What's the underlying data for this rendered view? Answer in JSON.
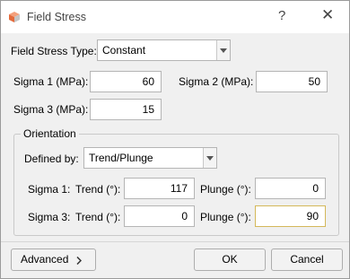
{
  "window": {
    "title": "Field Stress",
    "help_label": "?",
    "close_label": "✕",
    "icon_colors": [
      "#e46a3b",
      "#f3a07c",
      "#c4c4c4"
    ]
  },
  "field_stress_type": {
    "label": "Field Stress Type:",
    "value": "Constant"
  },
  "sigma": {
    "s1_label": "Sigma 1 (MPa):",
    "s1_value": "60",
    "s2_label": "Sigma 2 (MPa):",
    "s2_value": "50",
    "s3_label": "Sigma 3 (MPa):",
    "s3_value": "15"
  },
  "orientation": {
    "title": "Orientation",
    "defined_by_label": "Defined by:",
    "defined_by_value": "Trend/Plunge",
    "rows": [
      {
        "label": "Sigma 1:",
        "trend_label": "Trend (°):",
        "trend": "117",
        "plunge_label": "Plunge (°):",
        "plunge": "0"
      },
      {
        "label": "Sigma 3:",
        "trend_label": "Trend (°):",
        "trend": "0",
        "plunge_label": "Plunge (°):",
        "plunge": "90"
      }
    ]
  },
  "buttons": {
    "advanced": "Advanced",
    "advanced_icon": "chevron-right-icon",
    "ok": "OK",
    "cancel": "Cancel"
  },
  "colors": {
    "focus_border": "#d4b85a"
  }
}
